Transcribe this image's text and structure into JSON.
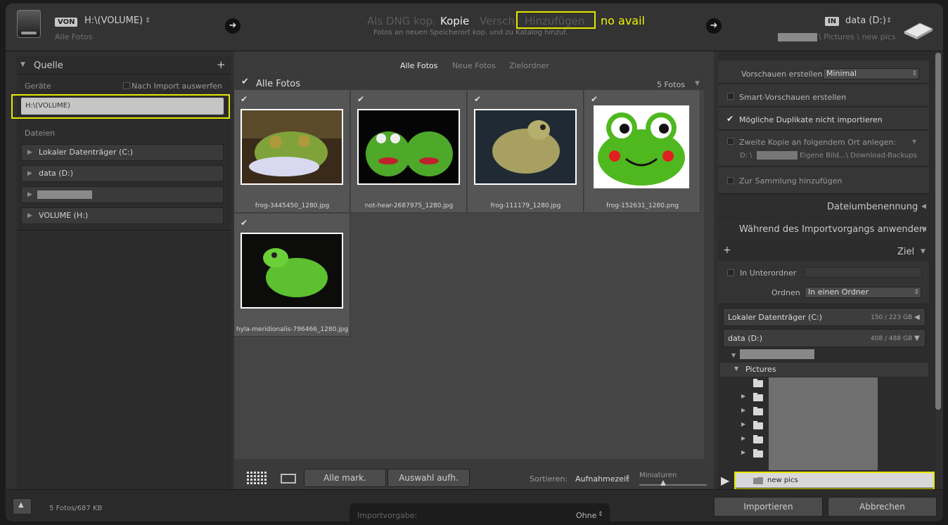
{
  "header": {
    "source_badge": "VON",
    "source_path": "H:\\(VOLUME)",
    "source_sub": "Alle Fotos",
    "modes": [
      "Als DNG kop.",
      "Kopie",
      "Versch.",
      "Hinzufügen"
    ],
    "active_mode": "Kopie",
    "mode_description": "Fotos an neuen Speicherort kop. und zu Katalog hinzuf.",
    "annotation": "no avail",
    "dest_badge": "IN",
    "dest_path": "data (D:)",
    "dest_sub": "\\ Pictures \\ new pics"
  },
  "left": {
    "title": "Quelle",
    "devices_label": "Geräte",
    "eject_label": "Nach Import auswerfen",
    "device_selected": "H:\\(VOLUME)",
    "files_label": "Dateien",
    "drives": [
      "Lokaler Datenträger (C:)",
      "data (D:)",
      "",
      "VOLUME (H:)"
    ]
  },
  "center": {
    "tabs": [
      "Alle Fotos",
      "Neue Fotos",
      "Zielordner"
    ],
    "grid_title": "Alle Fotos",
    "count": "5 Fotos",
    "photos": [
      {
        "name": "frog-3445450_1280.jpg"
      },
      {
        "name": "not-hear-2687975_1280.jpg"
      },
      {
        "name": "frog-111179_1280.jpg"
      },
      {
        "name": "frog-152631_1280.png"
      },
      {
        "name": "hyla-meridionalis-796466_1280.jpg"
      }
    ],
    "check_all": "Alle mark.",
    "uncheck_all": "Auswahl aufh.",
    "sort_label": "Sortieren:",
    "sort_value": "Aufnahmezeit",
    "thumbs_label": "Miniaturen"
  },
  "right": {
    "previews_label": "Vorschauen erstellen",
    "previews_value": "Minimal",
    "smart": "Smart-Vorschauen erstellen",
    "dupes": "Mögliche Duplikate nicht importieren",
    "second_copy": "Zweite Kopie an folgendem Ort anlegen:",
    "second_copy_path_prefix": "D: \\",
    "second_copy_path_suffix": "Eigene Bild...\\ Download-Backups",
    "collection": "Zur Sammlung hinzufügen",
    "rename_panel": "Dateiumbenennung",
    "apply_panel": "Während des Importvorgangs anwenden",
    "dest_panel": "Ziel",
    "subfolder_label": "In Unterordner",
    "organize_label": "Ordnen",
    "organize_value": "In einen Ordner",
    "drives": [
      {
        "name": "Lokaler Datenträger (C:)",
        "usage": "150 / 223 GB"
      },
      {
        "name": "data (D:)",
        "usage": "408 / 488 GB"
      }
    ],
    "pictures_folder": "Pictures",
    "new_folder": "new pics"
  },
  "footer": {
    "status": "5 Fotos/687 KB",
    "preset_label": "Importvorgabe:",
    "preset_value": "Ohne",
    "import_btn": "Importieren",
    "cancel_btn": "Abbrechen"
  }
}
